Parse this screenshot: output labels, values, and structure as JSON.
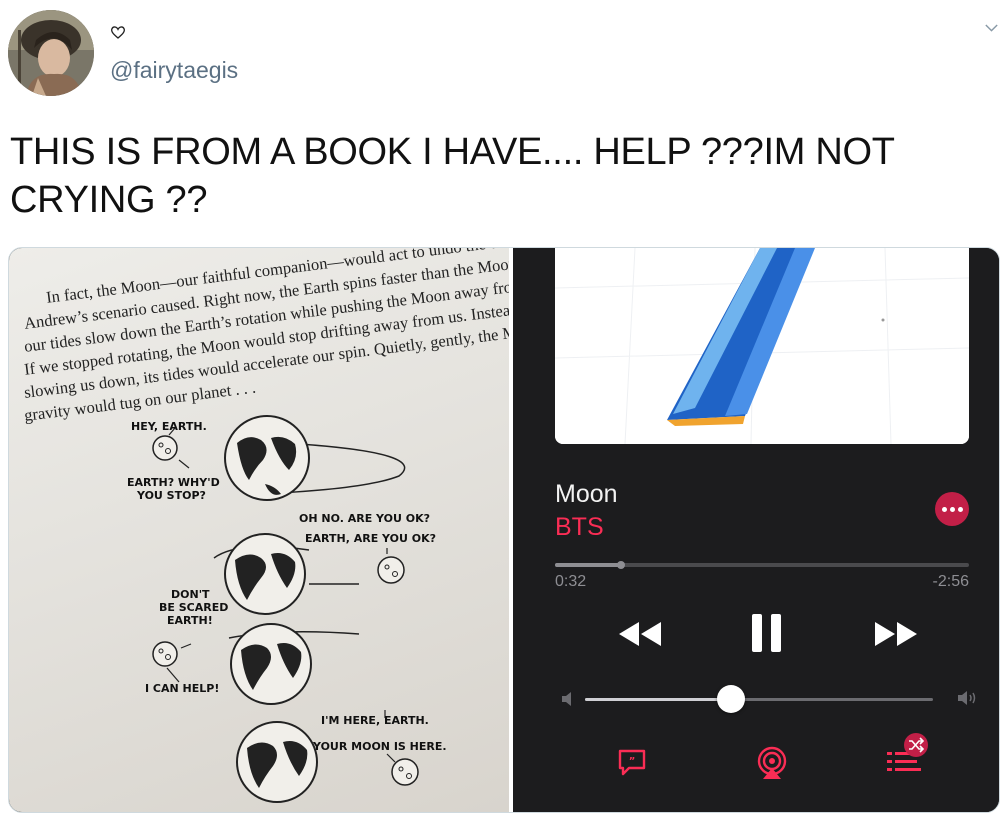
{
  "tweet": {
    "handle": "@fairytaegis",
    "text": "THIS IS FROM A BOOK I HAVE.... HELP ???IM NOT CRYING  ??",
    "icons": {
      "like": "heart-icon",
      "menu": "chevron-down-icon"
    }
  },
  "book_page": {
    "lines": [
      "In fact, the Moon—our faithful companion—would act to undo the damage",
      "Andrew’s scenario caused. Right now, the Earth spins faster than the Moon, and",
      "our tides slow down the Earth’s rotation while pushing the Moon away from us.",
      "If we stopped rotating, the Moon would stop drifting away from us. Instead of",
      "slowing us down, its tides would accelerate our spin. Quietly, gently, the Moon’s",
      "gravity would tug on our planet . . ."
    ],
    "comic": {
      "panel1_moon": "HEY, EARTH.",
      "panel1_earth": [
        "EARTH? WHY'D",
        "YOU STOP?"
      ],
      "panel2_moon": [
        "OH NO. ARE YOU OK?",
        "EARTH, ARE YOU OK?"
      ],
      "panel3_moon": [
        "DON'T",
        "BE SCARED",
        "EARTH!"
      ],
      "panel3_help": "I CAN HELP!",
      "panel4_moon": [
        "I'M HERE, EARTH.",
        "YOUR MOON IS HERE."
      ]
    }
  },
  "player": {
    "song_title": "Moon",
    "artist": "BTS",
    "elapsed": "0:32",
    "remaining": "-2:56",
    "progress_fraction": 0.16,
    "volume_fraction": 0.42,
    "state": "playing",
    "accent_color": "#fa2d55",
    "icons": {
      "rewind": "rewind-icon",
      "pause": "pause-icon",
      "fast_forward": "fast-forward-icon",
      "volume_low": "volume-low-icon",
      "volume_high": "volume-high-icon",
      "lyrics": "lyrics-icon",
      "airplay": "airplay-icon",
      "queue": "queue-icon",
      "shuffle": "shuffle-icon",
      "more": "more-icon"
    }
  }
}
